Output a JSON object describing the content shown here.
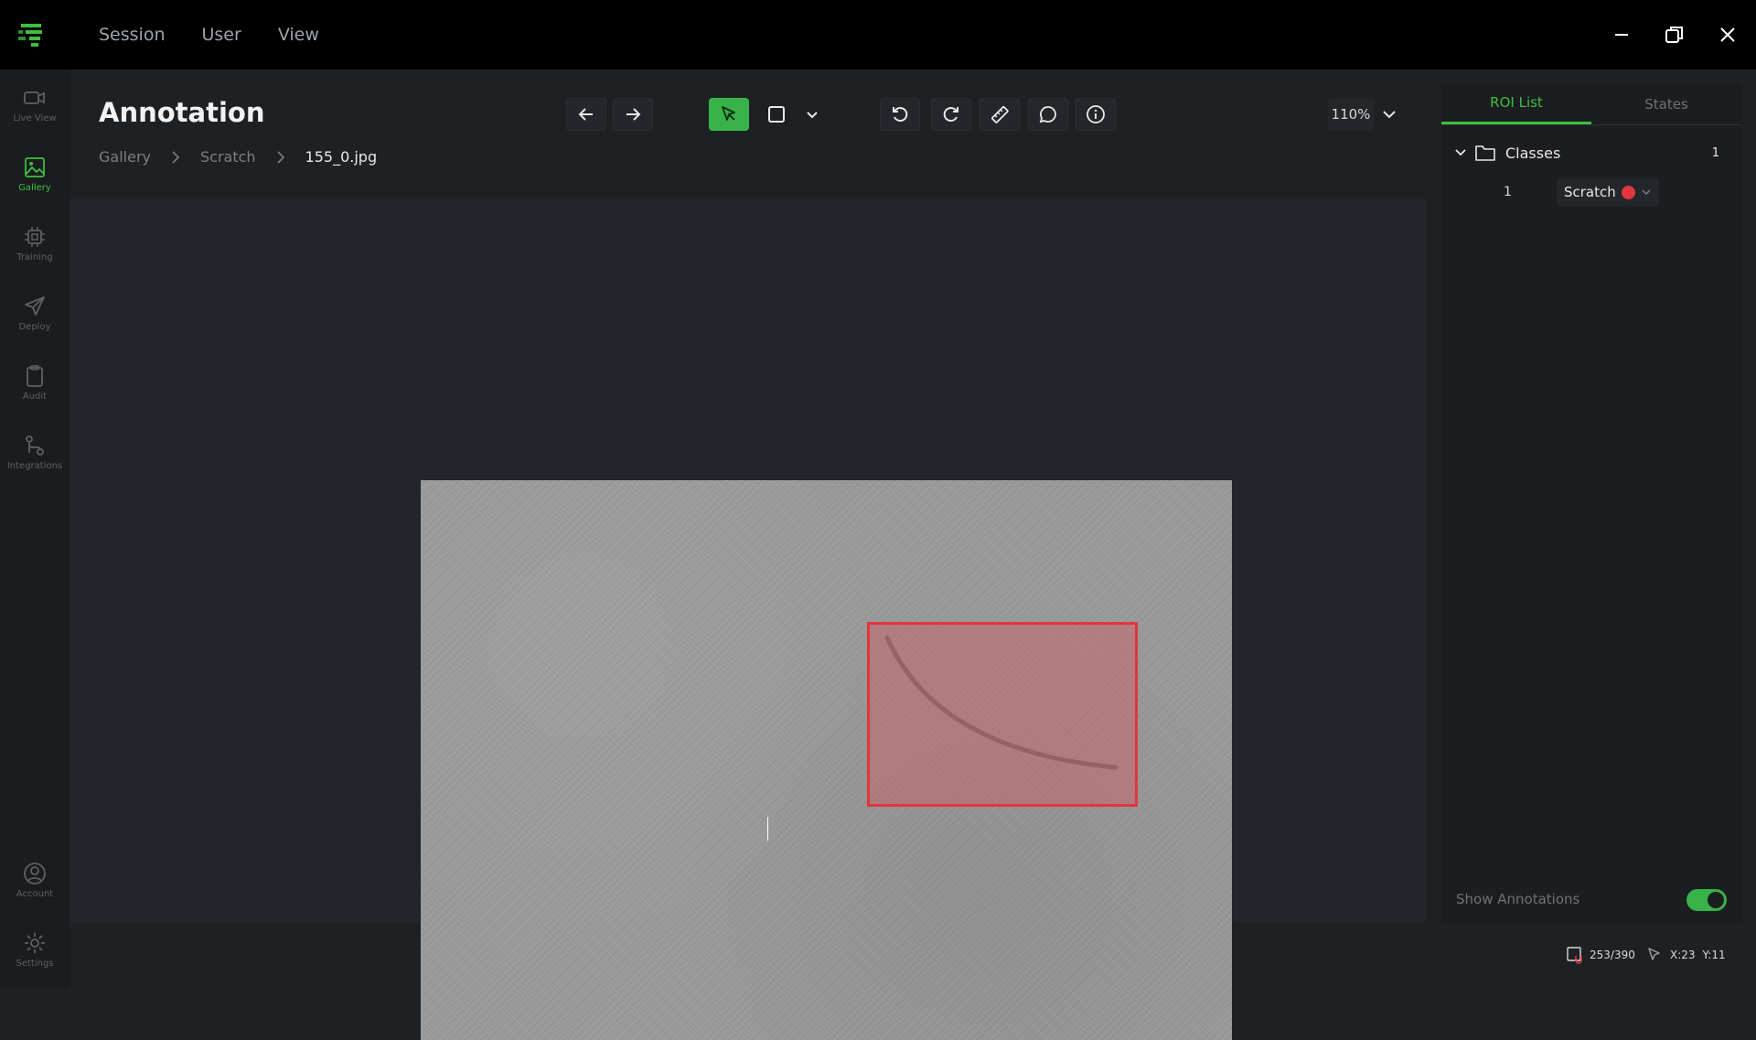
{
  "menu": {
    "session": "Session",
    "user": "User",
    "view": "View"
  },
  "sidebar": {
    "items": [
      {
        "label": "Live View",
        "icon": "video-camera-icon"
      },
      {
        "label": "Gallery",
        "icon": "image-icon"
      },
      {
        "label": "Training",
        "icon": "chip-icon"
      },
      {
        "label": "Deploy",
        "icon": "paper-plane-icon"
      },
      {
        "label": "Audit",
        "icon": "clipboard-icon"
      },
      {
        "label": "Integrations",
        "icon": "git-branch-icon"
      },
      {
        "label": "Account",
        "icon": "account-icon"
      },
      {
        "label": "Settings",
        "icon": "gear-icon"
      }
    ],
    "active": "Gallery"
  },
  "header": {
    "title": "Annotation"
  },
  "breadcrumb": {
    "items": [
      "Gallery",
      "Scratch",
      "155_0.jpg"
    ]
  },
  "toolbar": {
    "zoom": "110%"
  },
  "panel": {
    "tabs": [
      "ROI List",
      "States"
    ],
    "classes_label": "Classes",
    "classes_count": "1",
    "roi_items": [
      {
        "index": "1",
        "label": "Scratch",
        "color": "#e0363e"
      }
    ],
    "show_annotations_label": "Show Annotations",
    "show_annotations": true
  },
  "status": {
    "image_counter": "253/390",
    "x": "X:23",
    "y": "Y:11"
  },
  "colors": {
    "accent": "#37b34a",
    "roi": "#e0363e"
  }
}
